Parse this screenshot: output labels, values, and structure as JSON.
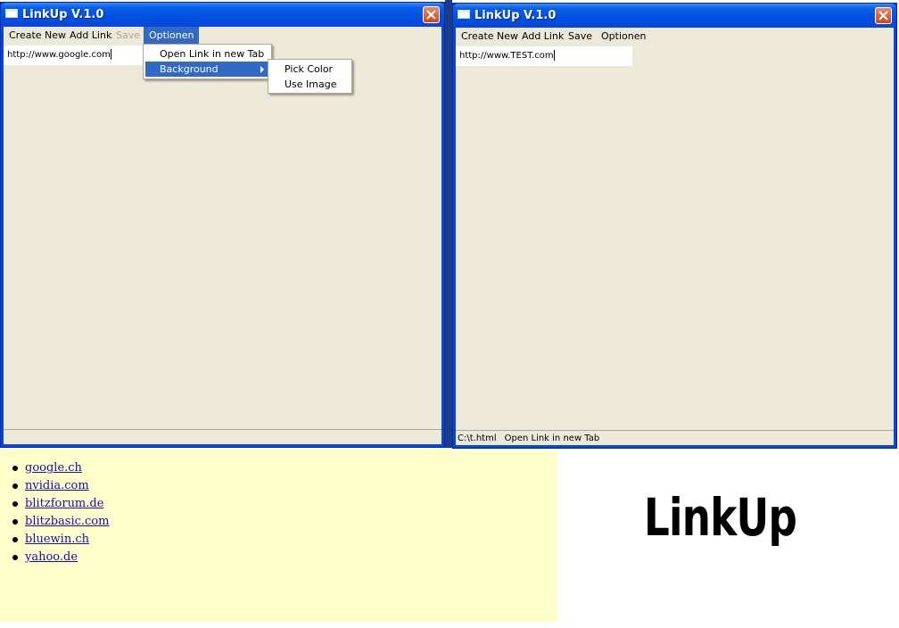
{
  "left_window": {
    "title": "LinkUp V.1.0",
    "menu": [
      {
        "label": "Create New",
        "state": "normal"
      },
      {
        "label": "Add Link",
        "state": "normal"
      },
      {
        "label": "Save",
        "state": "disabled"
      },
      {
        "label": "Optionen",
        "state": "active"
      }
    ],
    "url_value": "http://www.google.com",
    "optionen_menu": {
      "items": [
        {
          "label": "Open Link in new Tab"
        },
        {
          "label": "Background",
          "has_submenu": true
        }
      ]
    },
    "background_submenu": {
      "items": [
        {
          "label": "Pick Color"
        },
        {
          "label": "Use Image"
        }
      ]
    },
    "status": []
  },
  "right_window": {
    "title": "LinkUp V.1.0",
    "menu": [
      {
        "label": "Create New",
        "state": "normal"
      },
      {
        "label": "Add Link",
        "state": "normal"
      },
      {
        "label": "Save",
        "state": "normal"
      },
      {
        "label": "Optionen",
        "state": "normal"
      }
    ],
    "url_value": "http://www.TEST.com",
    "status": [
      "C:\\t.html",
      "Open Link in new Tab"
    ]
  },
  "link_list": {
    "links": [
      "google.ch",
      "nvidia.com",
      "blitzforum.de",
      "blitzbasic.com",
      "bluewin.ch",
      "yahoo.de"
    ]
  },
  "brand": {
    "logo_text": "LinkUp"
  },
  "colors": {
    "titlebar": "#0a45d8",
    "client_bg": "#ece9d8",
    "menu_highlight": "#316ac5",
    "link_panel_bg": "#ffffcc",
    "link_color": "#1a0dab",
    "close_button": "#d0451d"
  },
  "icons": {
    "window": "app-window-icon",
    "close": "close-icon",
    "submenu": "chevron-right-icon",
    "bullet": "bullet-icon"
  }
}
